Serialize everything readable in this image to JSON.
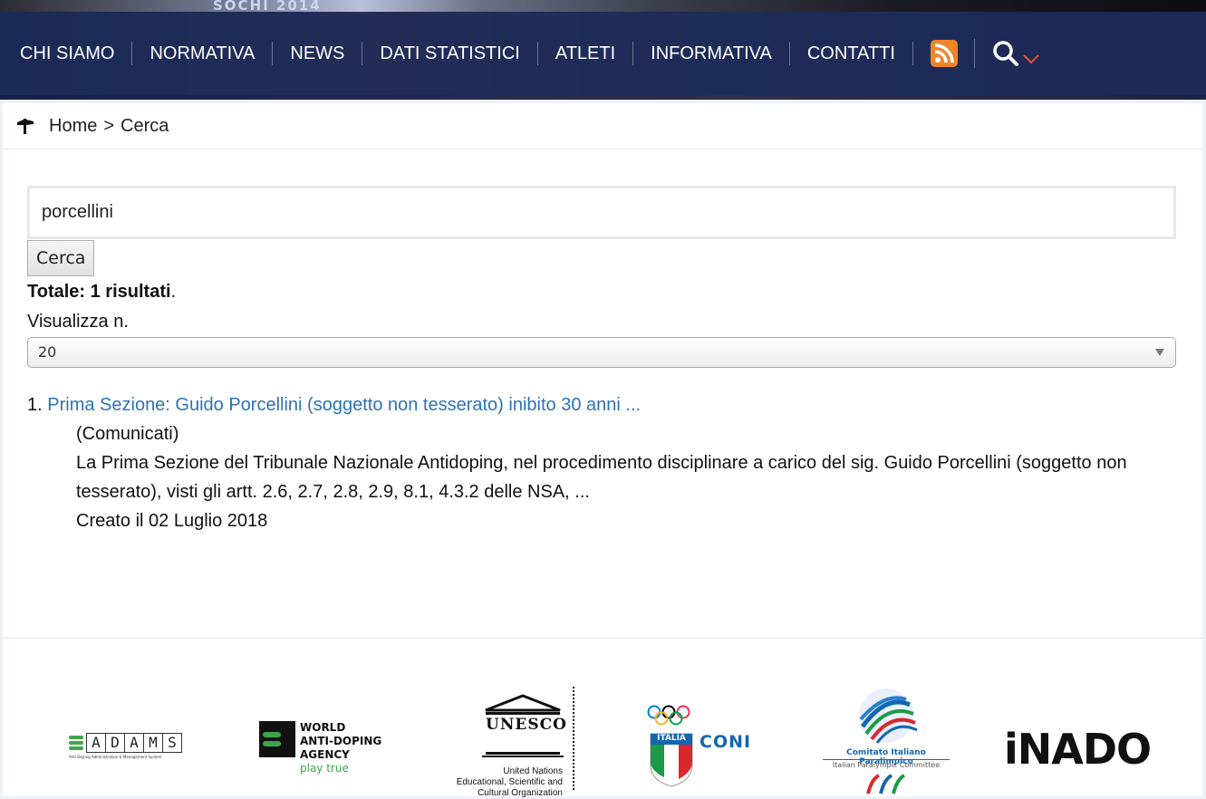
{
  "hero": {
    "jersey_text": "SOCHI 2014"
  },
  "nav": {
    "items": [
      "CHI SIAMO",
      "NORMATIVA",
      "NEWS",
      "DATI STATISTICI",
      "ATLETI",
      "INFORMATIVA",
      "CONTATTI"
    ],
    "rss_icon": "rss-icon",
    "search_icon": "search-icon",
    "chevron_icon": "chevron-down-icon",
    "accent_color": "#f0852a",
    "chevron_color": "#e8543f"
  },
  "breadcrumb": {
    "icon": "signpost-icon",
    "home": "Home",
    "separator": ">",
    "current": "Cerca"
  },
  "search": {
    "value": "porcellini",
    "button_label": "Cerca",
    "total_prefix": "Totale: 1 risultati",
    "total_suffix": ".",
    "display_label": "Visualizza n.",
    "display_selected": "20"
  },
  "results": [
    {
      "number": "1.",
      "title": "Prima Sezione: Guido Porcellini (soggetto non tesserato) inibito 30 anni ...",
      "category": "(Comunicati)",
      "snippet": "La Prima Sezione del Tribunale Nazionale Antidoping, nel procedimento disciplinare a carico del sig. Guido Porcellini (soggetto non tesserato), visti gli artt. 2.6, 2.7, 2.8, 2.9, 8.1, 4.3.2 delle NSA, ...",
      "date": "Creato il 02 Luglio 2018"
    }
  ],
  "footer": {
    "adams": {
      "name": "ADAMS",
      "letters": [
        "A",
        "D",
        "A",
        "M",
        "S"
      ],
      "tagline": "Anti-Doping Administration & Management System"
    },
    "wada": {
      "line1": "WORLD",
      "line2": "ANTI-DOPING",
      "line3": "AGENCY",
      "tagline": "play true"
    },
    "unesco": {
      "name": "UNESCO",
      "line1": "United Nations",
      "line2": "Educational, Scientific and",
      "line3": "Cultural Organization"
    },
    "coni": {
      "name": "CONI",
      "badge": "ITALIA"
    },
    "cip": {
      "line1": "Comitato Italiano Paralimpico",
      "line2": "Italian Paralympic Committee"
    },
    "inado": {
      "name": "iNADO"
    }
  }
}
